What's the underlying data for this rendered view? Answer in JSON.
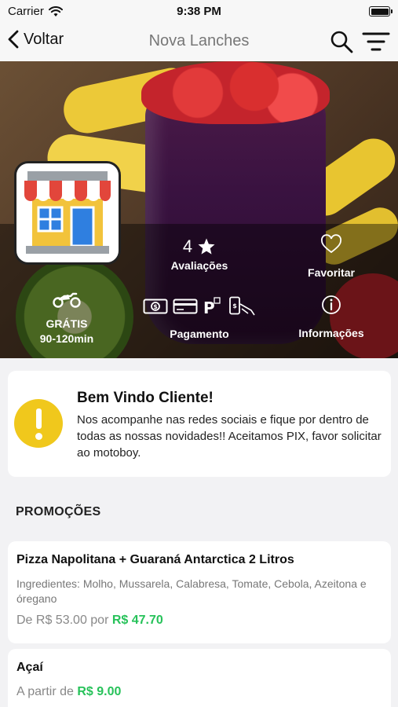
{
  "status_bar": {
    "carrier": "Carrier",
    "time": "9:38 PM"
  },
  "nav": {
    "back_label": "Voltar",
    "title": "Nova Lanches"
  },
  "store": {
    "rating_value": "4",
    "rating_label": "Avaliações",
    "favorite_label": "Favoritar",
    "delivery_fee": "GRÁTIS",
    "delivery_time": "90-120min",
    "payment_label": "Pagamento",
    "info_label": "Informações"
  },
  "welcome": {
    "title": "Bem Vindo Cliente!",
    "text": "Nos acompanhe nas redes sociais e fique por dentro de todas as nossas novidades!! Aceitamos PIX, favor solicitar ao motoboy."
  },
  "promotions": {
    "section_title": "PROMOÇÕES",
    "items": [
      {
        "name": "Pizza Napolitana + Guaraná Antarctica 2 Litros",
        "description": "Ingredientes: Molho, Mussarela, Calabresa, Tomate, Cebola, Azeitona e óregano",
        "price_prefix": "De R$ 53.00 por ",
        "price": "R$ 47.70"
      },
      {
        "name": "Açaí",
        "description": "",
        "price_prefix": "A partir de ",
        "price": "R$ 9.00"
      }
    ]
  },
  "colors": {
    "accent_green": "#27c25a",
    "warning_yellow": "#f0c81c"
  }
}
